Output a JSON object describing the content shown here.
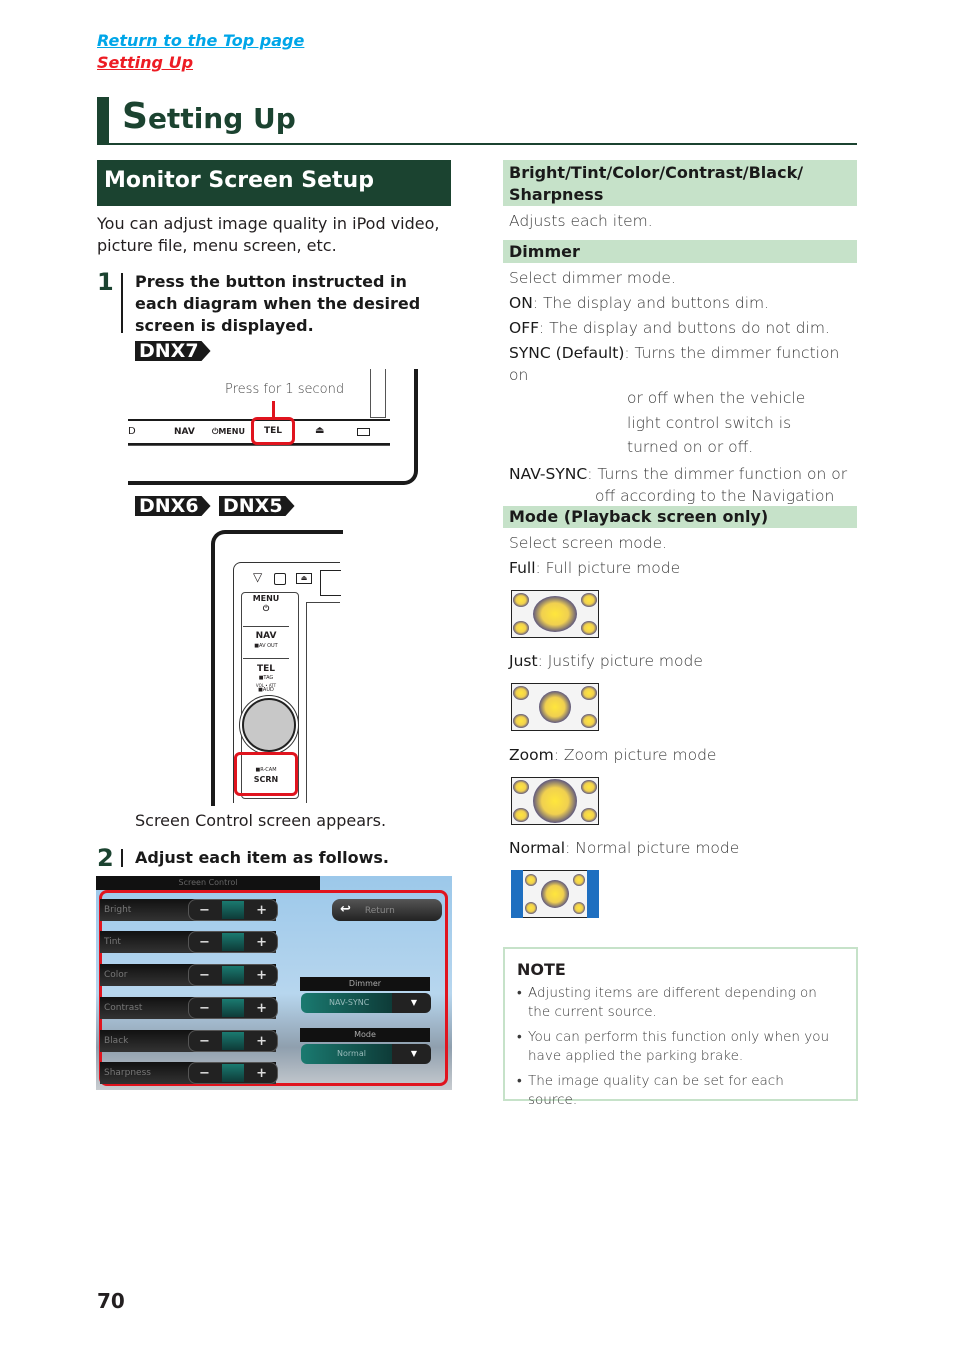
{
  "nav": {
    "return_top": "Return to the Top page",
    "section_link": "Setting Up"
  },
  "page_title": {
    "first_letter": "S",
    "rest": "etting Up"
  },
  "left": {
    "section_title": "Monitor Screen Setup",
    "intro": "You can adjust image quality in iPod video, picture file, menu screen, etc.",
    "step1": {
      "num": "1",
      "text": "Press the button instructed in each diagram when the desired screen is displayed."
    },
    "dnx7": {
      "badge": "DNX7",
      "callout": "Press for 1 second",
      "buttons": [
        "D",
        "NAV",
        "⏻MENU",
        "TEL",
        "⏏"
      ]
    },
    "dnx65": {
      "badges": [
        "DNX6",
        "DNX5"
      ],
      "buttons": {
        "menu": "MENU",
        "menu_sub": "⏻",
        "nav": "NAV",
        "nav_sub": "■AV OUT",
        "tel": "TEL",
        "tel_sub": "■TAG",
        "vol": "VOL • ATT",
        "aud": "■AUD",
        "rcam": "■R-CAM",
        "scrn": "SCRN"
      }
    },
    "screen_appears": "Screen Control screen appears.",
    "step2": {
      "num": "2",
      "text": "Adjust each item as follows."
    },
    "screen_control": {
      "title": "Screen Control",
      "items": [
        "Bright",
        "Tint",
        "Color",
        "Contrast",
        "Black",
        "Sharpness"
      ],
      "minus": "−",
      "plus": "+",
      "return": "Return",
      "dimmer_label": "Dimmer",
      "dimmer_value": "NAV-SYNC",
      "mode_label": "Mode",
      "mode_value": "Normal",
      "dropdown_arrow": "▼"
    }
  },
  "right": {
    "h1": "Bright/Tint/Color/Contrast/Black/ Sharpness",
    "h1_desc": "Adjusts each item.",
    "h2": "Dimmer",
    "dimmer": {
      "intro": "Select dimmer mode.",
      "on_k": "ON",
      "on_v": ": The display and buttons dim.",
      "off_k": "OFF",
      "off_v": ": The display and buttons do not dim.",
      "sync_k": "SYNC (Default)",
      "sync_v": ": Turns the dimmer function on",
      "sync_cont": "or off when the vehicle light control switch is turned on or off.",
      "navsync_k": "NAV-SYNC",
      "navsync_v": ": Turns the dimmer function on or",
      "navsync_cont": "off according to the Navigation Day/Night display setting."
    },
    "h3": "Mode (Playback screen only)",
    "mode": {
      "intro": "Select screen mode.",
      "items": [
        {
          "k": "Full",
          "v": ": Full picture mode"
        },
        {
          "k": "Just",
          "v": ": Justify picture mode"
        },
        {
          "k": "Zoom",
          "v": ": Zoom picture mode"
        },
        {
          "k": "Normal",
          "v": ": Normal picture mode"
        }
      ]
    },
    "note": {
      "title": "NOTE",
      "items": [
        "Adjusting items are different depending on the current source.",
        "You can perform this function only when you have applied the parking brake.",
        "The image quality can be set for each source."
      ]
    }
  },
  "page_number": "70",
  "colors": {
    "link_blue": "#00a6e8",
    "link_red": "#ed1c24",
    "dark_green": "#1b4330",
    "light_green": "#c6e2c9",
    "highlight_red": "#e0141e"
  }
}
